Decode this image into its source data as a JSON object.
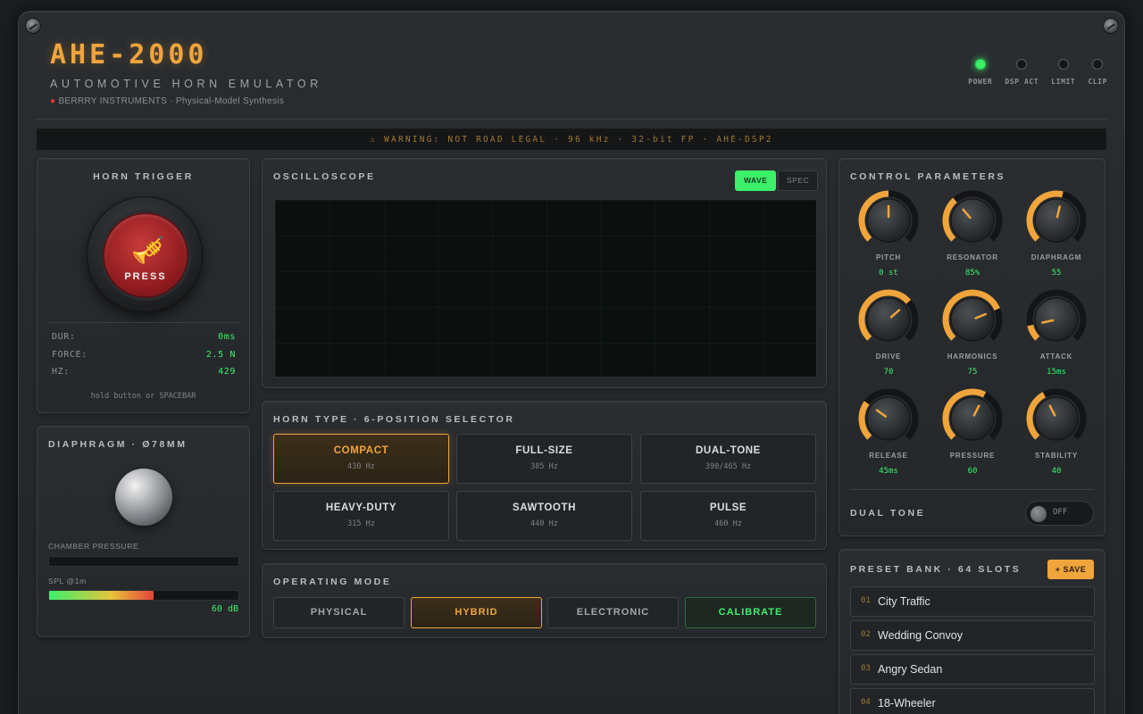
{
  "header": {
    "title": "AHE-2000",
    "subtitle": "AUTOMOTIVE HORN EMULATOR",
    "maker": "BERRRY INSTRUMENTS · Physical-Model Synthesis",
    "leds": [
      {
        "label": "POWER",
        "on": true
      },
      {
        "label": "DSP ACT",
        "on": false
      },
      {
        "label": "LIMIT",
        "on": false
      },
      {
        "label": "CLIP",
        "on": false
      }
    ]
  },
  "warning": "⚠ WARNING: NOT ROAD LEGAL · 96 kHz · 32-bit FP · AHE-DSP2",
  "trigger": {
    "title": "HORN TRIGGER",
    "button_label": "PRESS",
    "stats": [
      {
        "label": "DUR:",
        "value": "0ms"
      },
      {
        "label": "FORCE:",
        "value": "2.5 N"
      },
      {
        "label": "HZ:",
        "value": "429"
      }
    ],
    "hint": "hold button or SPACEBAR"
  },
  "diaphragm": {
    "title": "DIAPHRAGM · Ø78MM",
    "chamber_label": "CHAMBER PRESSURE",
    "chamber_level": 0,
    "spl_label": "SPL @1m",
    "spl_level": 0.55,
    "spl_value": "60 dB"
  },
  "scope": {
    "title": "OSCILLOSCOPE",
    "wave_label": "WAVE",
    "spec_label": "SPEC",
    "active_view": "WAVE"
  },
  "horn_type": {
    "title": "HORN TYPE · 6-POSITION SELECTOR",
    "selected": "COMPACT",
    "options": [
      {
        "name": "COMPACT",
        "freq": "430 Hz"
      },
      {
        "name": "FULL-SIZE",
        "freq": "385 Hz"
      },
      {
        "name": "DUAL-TONE",
        "freq": "390/465 Hz"
      },
      {
        "name": "HEAVY-DUTY",
        "freq": "315 Hz"
      },
      {
        "name": "SAWTOOTH",
        "freq": "440 Hz"
      },
      {
        "name": "PULSE",
        "freq": "460 Hz"
      }
    ]
  },
  "mode": {
    "title": "OPERATING MODE",
    "selected": "HYBRID",
    "options": [
      "PHYSICAL",
      "HYBRID",
      "ELECTRONIC"
    ],
    "calibrate_label": "CALIBRATE"
  },
  "controls": {
    "title": "CONTROL PARAMETERS",
    "knobs": [
      {
        "label": "PITCH",
        "value": "0 st",
        "level": 0.5
      },
      {
        "label": "RESONATOR",
        "value": "85%",
        "level": 0.35
      },
      {
        "label": "DIAPHRAGM",
        "value": "55",
        "level": 0.55
      },
      {
        "label": "DRIVE",
        "value": "70",
        "level": 0.68
      },
      {
        "label": "HARMONICS",
        "value": "75",
        "level": 0.75
      },
      {
        "label": "ATTACK",
        "value": "15ms",
        "level": 0.12
      },
      {
        "label": "RELEASE",
        "value": "45ms",
        "level": 0.3
      },
      {
        "label": "PRESSURE",
        "value": "60",
        "level": 0.6
      },
      {
        "label": "STABILITY",
        "value": "40",
        "level": 0.4
      }
    ],
    "dual_tone_label": "DUAL TONE",
    "dual_tone_state": "OFF"
  },
  "presets": {
    "title": "PRESET BANK · 64 SLOTS",
    "save_label": "+ SAVE",
    "items": [
      {
        "num": "01",
        "name": "City Traffic"
      },
      {
        "num": "02",
        "name": "Wedding Convoy"
      },
      {
        "num": "03",
        "name": "Angry Sedan"
      },
      {
        "num": "04",
        "name": "18-Wheeler"
      }
    ]
  },
  "colors": {
    "accent": "#f0a53c",
    "led_green": "#3cf06a",
    "trigger_red": "#b0272b",
    "panel": "#2a2d30"
  }
}
